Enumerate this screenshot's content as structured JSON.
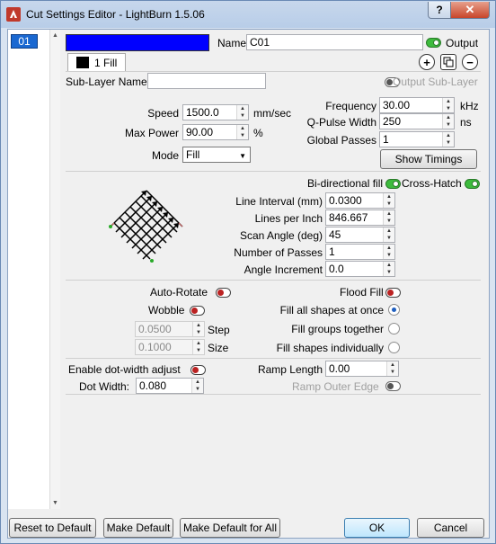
{
  "window": {
    "title": "Cut Settings Editor - LightBurn 1.5.06",
    "help_glyph": "?",
    "close_glyph": "✕"
  },
  "layers": {
    "items": [
      "01"
    ]
  },
  "header": {
    "color": "#0000ff",
    "name_label": "Name",
    "name_value": "C01",
    "output_label": "Output",
    "output_on": true,
    "tab_label": "1 Fill",
    "sublayer_name_label": "Sub-Layer Name",
    "sublayer_name_value": "",
    "output_sublayer_label": "Output Sub-Layer",
    "add_icon": "plus-circle-icon",
    "duplicate_icon": "duplicate-icon",
    "remove_icon": "minus-circle-icon"
  },
  "params": {
    "speed_label": "Speed",
    "speed_value": "1500.0",
    "speed_unit": "mm/sec",
    "maxpower_label": "Max Power",
    "maxpower_value": "90.00",
    "maxpower_unit": "%",
    "mode_label": "Mode",
    "mode_value": "Fill",
    "frequency_label": "Frequency",
    "frequency_value": "30.00",
    "frequency_unit": "kHz",
    "qpulse_label": "Q-Pulse Width",
    "qpulse_value": "250",
    "qpulse_unit": "ns",
    "globalpasses_label": "Global Passes",
    "globalpasses_value": "1",
    "show_timings_label": "Show Timings"
  },
  "fill": {
    "bidir_label": "Bi-directional fill",
    "bidir_on": true,
    "crosshatch_label": "Cross-Hatch",
    "crosshatch_on": true,
    "interval_label": "Line Interval (mm)",
    "interval_value": "0.0300",
    "lpi_label": "Lines per Inch",
    "lpi_value": "846.667",
    "angle_label": "Scan Angle (deg)",
    "angle_value": "45",
    "passes_label": "Number of Passes",
    "passes_value": "1",
    "angle_inc_label": "Angle Increment",
    "angle_inc_value": "0.0"
  },
  "options": {
    "autorotate_label": "Auto-Rotate",
    "floodfill_label": "Flood Fill",
    "wobble_label": "Wobble",
    "step_value": "0.0500",
    "step_label": "Step",
    "size_value": "0.1000",
    "size_label": "Size",
    "fill_all_label": "Fill all shapes at once",
    "fill_groups_label": "Fill groups together",
    "fill_individual_label": "Fill shapes individually",
    "selected_fill_mode": "Fill all shapes at once"
  },
  "dot": {
    "enable_label": "Enable dot-width adjust",
    "dotwidth_label": "Dot Width:",
    "dotwidth_value": "0.080",
    "ramp_label": "Ramp Length",
    "ramp_value": "0.00",
    "ramp_outer_label": "Ramp Outer Edge"
  },
  "footer": {
    "reset_label": "Reset to Default",
    "make_default_label": "Make Default",
    "make_default_all_label": "Make Default for All",
    "ok_label": "OK",
    "cancel_label": "Cancel"
  }
}
